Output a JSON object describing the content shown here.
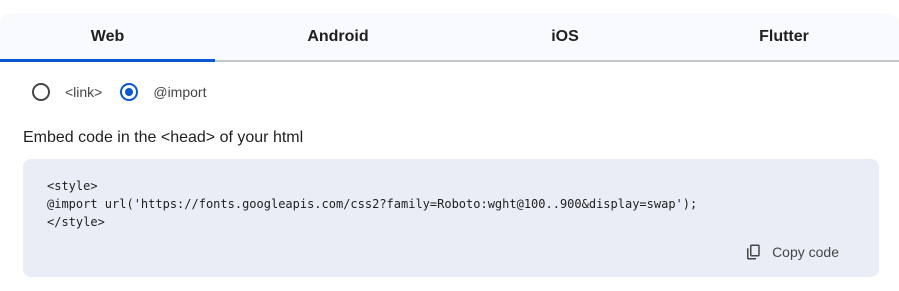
{
  "tabs": [
    {
      "label": "Web",
      "active": true
    },
    {
      "label": "Android",
      "active": false
    },
    {
      "label": "iOS",
      "active": false
    },
    {
      "label": "Flutter",
      "active": false
    }
  ],
  "embed_options": [
    {
      "label": "<link>",
      "selected": false
    },
    {
      "label": "@import",
      "selected": true
    }
  ],
  "instruction": "Embed code in the <head> of your html",
  "code_lines": [
    "<style>",
    "@import url('https://fonts.googleapis.com/css2?family=Roboto:wght@100..900&display=swap');",
    "</style>"
  ],
  "copy_button": {
    "label": "Copy code",
    "icon": "copy-icon"
  },
  "colors": {
    "accent": "#0b57d0",
    "code_background": "#e9eef6",
    "tab_background": "#f8fafd"
  }
}
